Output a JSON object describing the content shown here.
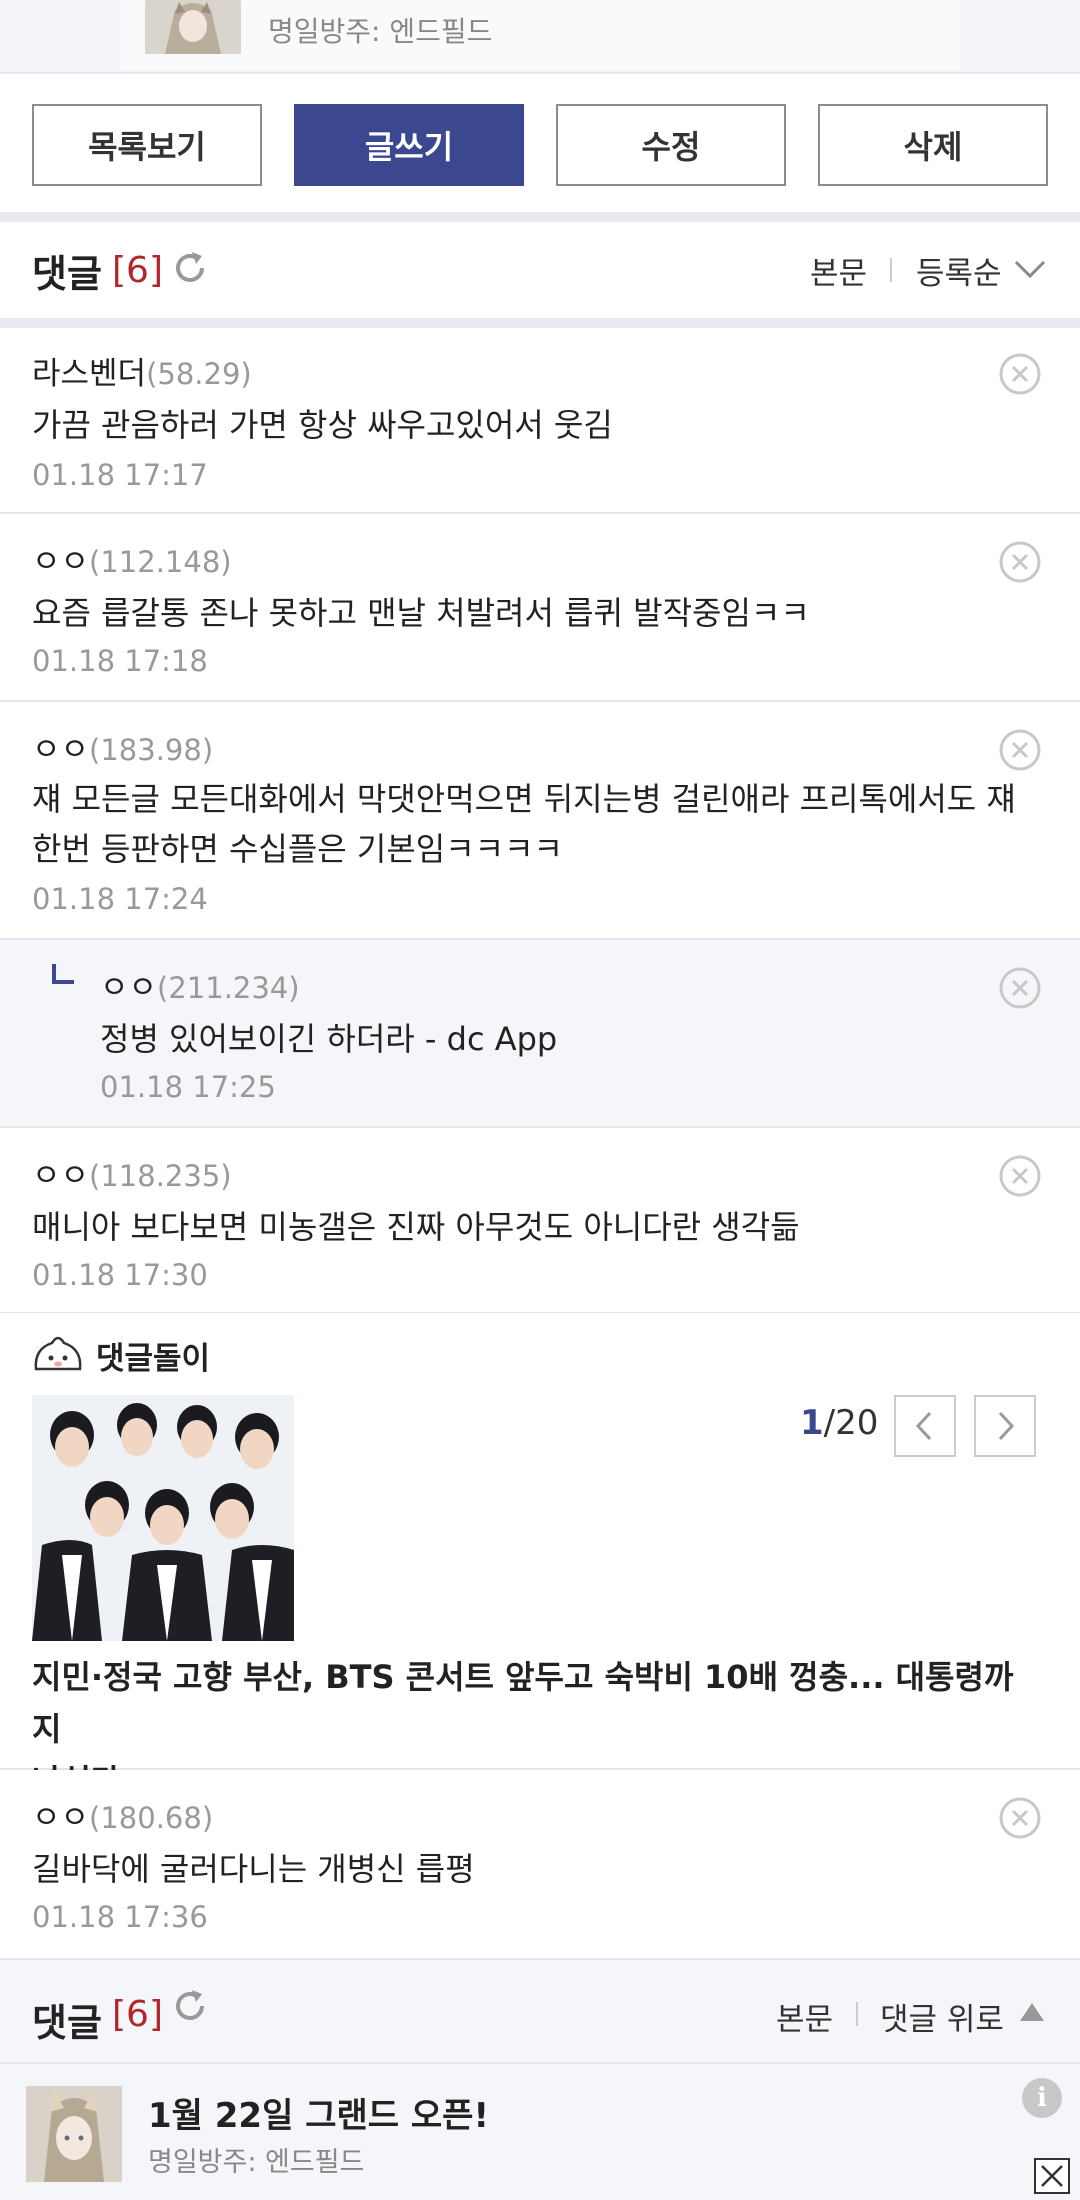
{
  "top_ad": {
    "subtitle": "명일방주: 엔드필드"
  },
  "actions": {
    "list": "목록보기",
    "write": "글쓰기",
    "edit": "수정",
    "delete": "삭제"
  },
  "comments_header": {
    "title": "댓글",
    "count": "[6]",
    "body_link": "본문",
    "sort": "등록순"
  },
  "comments": [
    {
      "nick": "라스벤더",
      "ip": "(58.29)",
      "body": "가끔 관음하러 가면 항상 싸우고있어서 웃김",
      "date": "01.18 17:17"
    },
    {
      "nick": "ㅇㅇ",
      "ip": "(112.148)",
      "body": "요즘 릅갈통 존나 못하고 맨날 처발려서 릅퀴 발작중임ㅋㅋ",
      "date": "01.18 17:18"
    },
    {
      "nick": "ㅇㅇ",
      "ip": "(183.98)",
      "body_line1": "쟤 모든글 모든대화에서 막댓안먹으면 뒤지는병 걸린애라 프리톡에서도 쟤",
      "body_line2": "한번 등판하면 수십플은 기본임ㅋㅋㅋㅋ",
      "date": "01.18 17:24"
    },
    {
      "nick": "ㅇㅇ",
      "ip": "(211.234)",
      "body": "정병 있어보이긴 하더라 - dc App",
      "date": "01.18 17:25",
      "reply": true
    },
    {
      "nick": "ㅇㅇ",
      "ip": "(118.235)",
      "body": "매니아 보다보면 미농갤은 진짜 아무것도 아니다란 생각듦",
      "date": "01.18 17:30"
    },
    {
      "nick": "ㅇㅇ",
      "ip": "(180.68)",
      "body": "길바닥에 굴러다니는 개병신 릅평",
      "date": "01.18 17:36"
    }
  ],
  "bot": {
    "label": "댓글돌이",
    "page_current": "1",
    "page_total": "/20",
    "headline_line1": "지민·정국 고향 부산, BTS 콘서트 앞두고 숙박비 10배 껑충... 대통령까지",
    "headline_line2": "나섰다"
  },
  "bottom_header": {
    "title": "댓글",
    "count": "[6]",
    "body_link": "본문",
    "up": "댓글 위로"
  },
  "bottom_ad": {
    "title": "1월 22일 그랜드 오픈!",
    "subtitle": "명일방주: 엔드필드"
  },
  "colors": {
    "primary": "#3b4890",
    "count": "#b0262a"
  },
  "icons": [
    "refresh-icon",
    "chevron-down-icon",
    "delete-circle-icon",
    "reply-icon",
    "bot-icon",
    "chevron-left-icon",
    "chevron-right-icon",
    "triangle-up-icon",
    "info-icon",
    "close-icon"
  ]
}
